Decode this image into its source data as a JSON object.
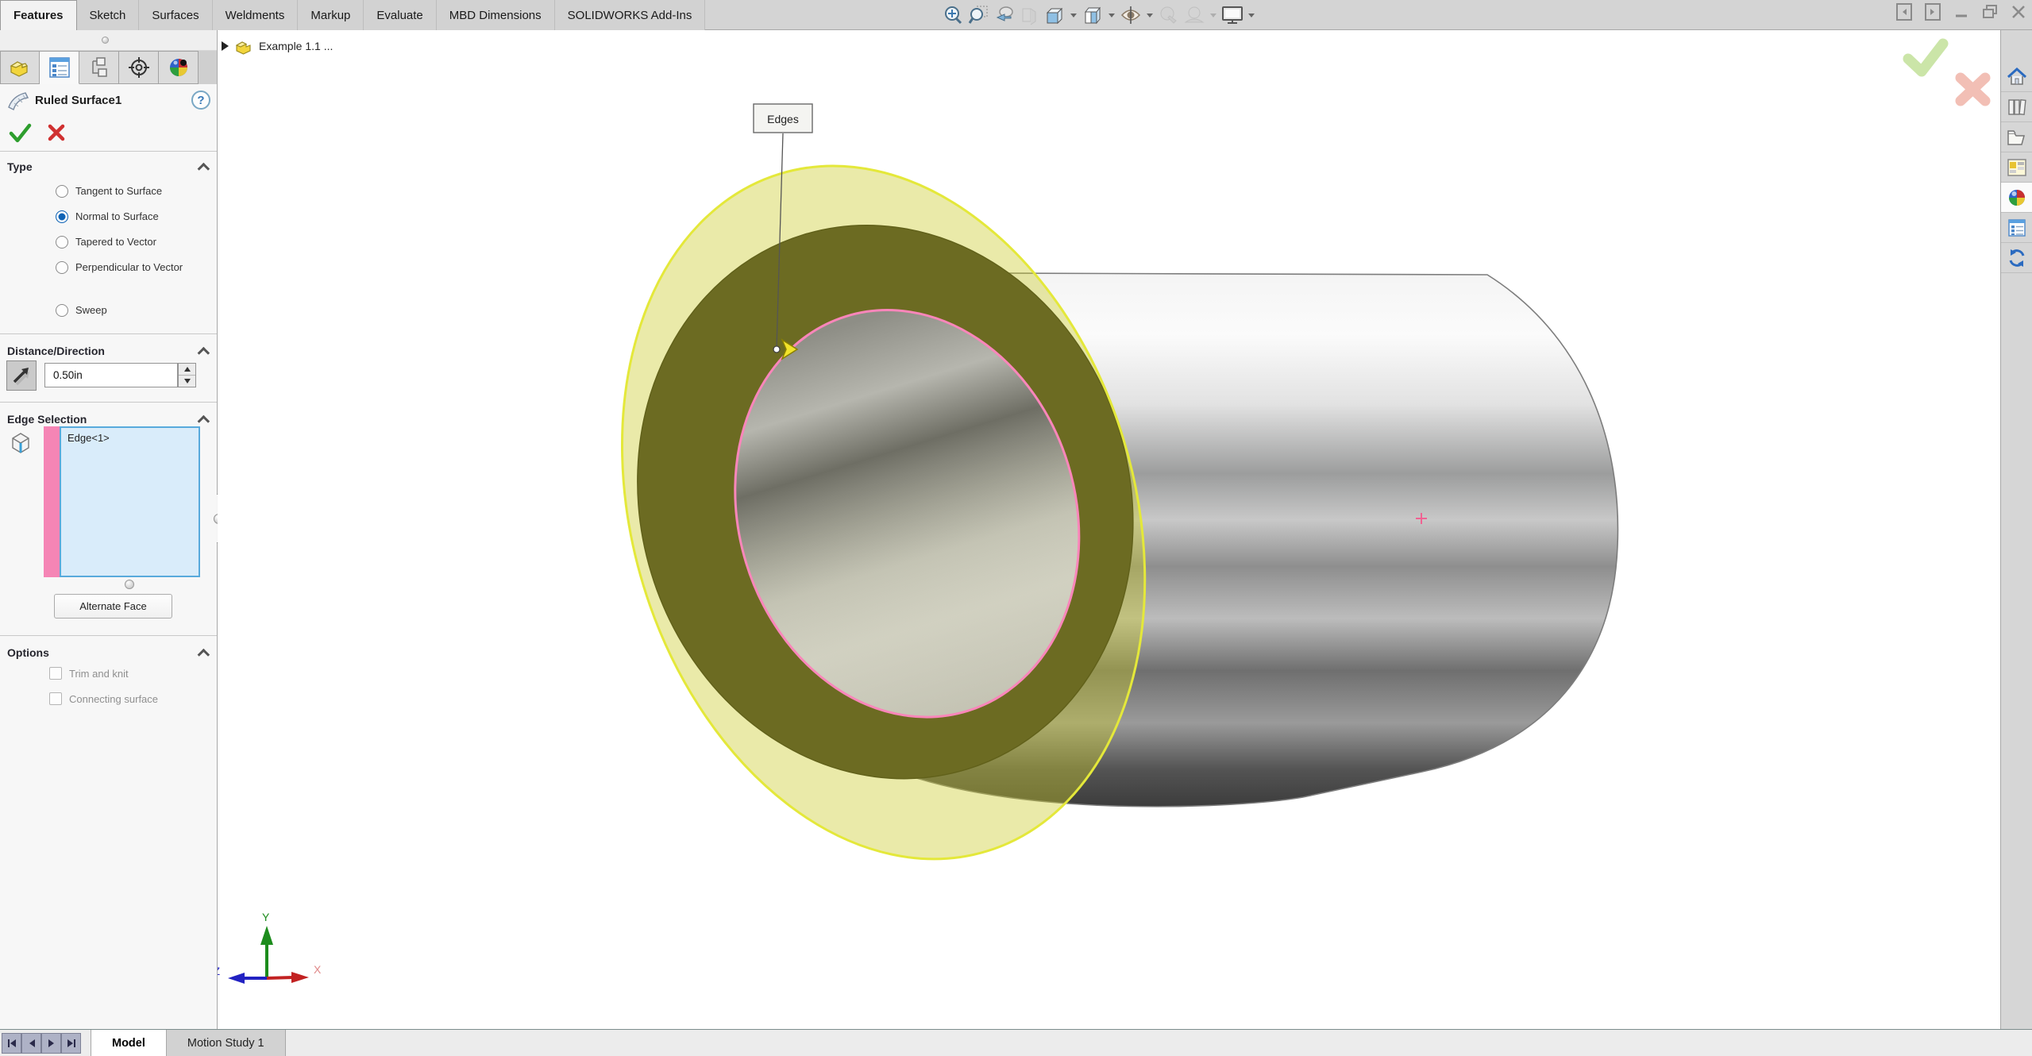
{
  "menu": {
    "tabs": [
      {
        "label": "Features",
        "active": true
      },
      {
        "label": "Sketch",
        "active": false
      },
      {
        "label": "Surfaces",
        "active": false
      },
      {
        "label": "Weldments",
        "active": false
      },
      {
        "label": "Markup",
        "active": false
      },
      {
        "label": "Evaluate",
        "active": false
      },
      {
        "label": "MBD Dimensions",
        "active": false
      },
      {
        "label": "SOLIDWORKS Add-Ins",
        "active": false
      }
    ]
  },
  "headsup_icons": [
    "zoom-to-fit",
    "zoom-to-area",
    "previous-view",
    "section-view",
    "view-orientation",
    "display-style",
    "hide-show-items",
    "edit-appearance",
    "apply-scene",
    "view-settings"
  ],
  "window_controls": [
    "collapse-pane-left",
    "collapse-pane-right",
    "minimize",
    "restore",
    "close"
  ],
  "panel": {
    "tabs": [
      "feature-manager",
      "property-manager",
      "configuration-manager",
      "dimxpert-manager",
      "display-manager"
    ],
    "active_tab_index": 1,
    "title": "Ruled Surface1",
    "help_label": "?",
    "type_section": {
      "title": "Type",
      "options": [
        {
          "label": "Tangent to Surface",
          "selected": false
        },
        {
          "label": "Normal to Surface",
          "selected": true
        },
        {
          "label": "Tapered to Vector",
          "selected": false
        },
        {
          "label": "Perpendicular to Vector",
          "selected": false
        },
        {
          "label": "Sweep",
          "selected": false
        }
      ]
    },
    "distance_section": {
      "title": "Distance/Direction",
      "value": "0.50in"
    },
    "edge_selection_section": {
      "title": "Edge Selection",
      "items": [
        "Edge<1>"
      ],
      "button_label": "Alternate Face"
    },
    "options_section": {
      "title": "Options",
      "checkboxes": [
        {
          "label": "Trim and knit",
          "checked": false
        },
        {
          "label": "Connecting surface",
          "checked": false
        }
      ]
    }
  },
  "viewport": {
    "tree_item": "Example 1.1 ...",
    "callout": "Edges",
    "triad": {
      "x": "X",
      "y": "Y",
      "z": "Z"
    }
  },
  "bottom": {
    "tabs": [
      {
        "label": "Model",
        "active": true
      },
      {
        "label": "Motion Study 1",
        "active": false
      }
    ]
  },
  "colors": {
    "selection_pink": "#f585b5",
    "preview_yellow": "#e4e83a",
    "selection_list_bg": "#d9ecfa",
    "accent_blue": "#0f63b5",
    "ok_green": "#2e9e2e",
    "cancel_red": "#d03030"
  }
}
